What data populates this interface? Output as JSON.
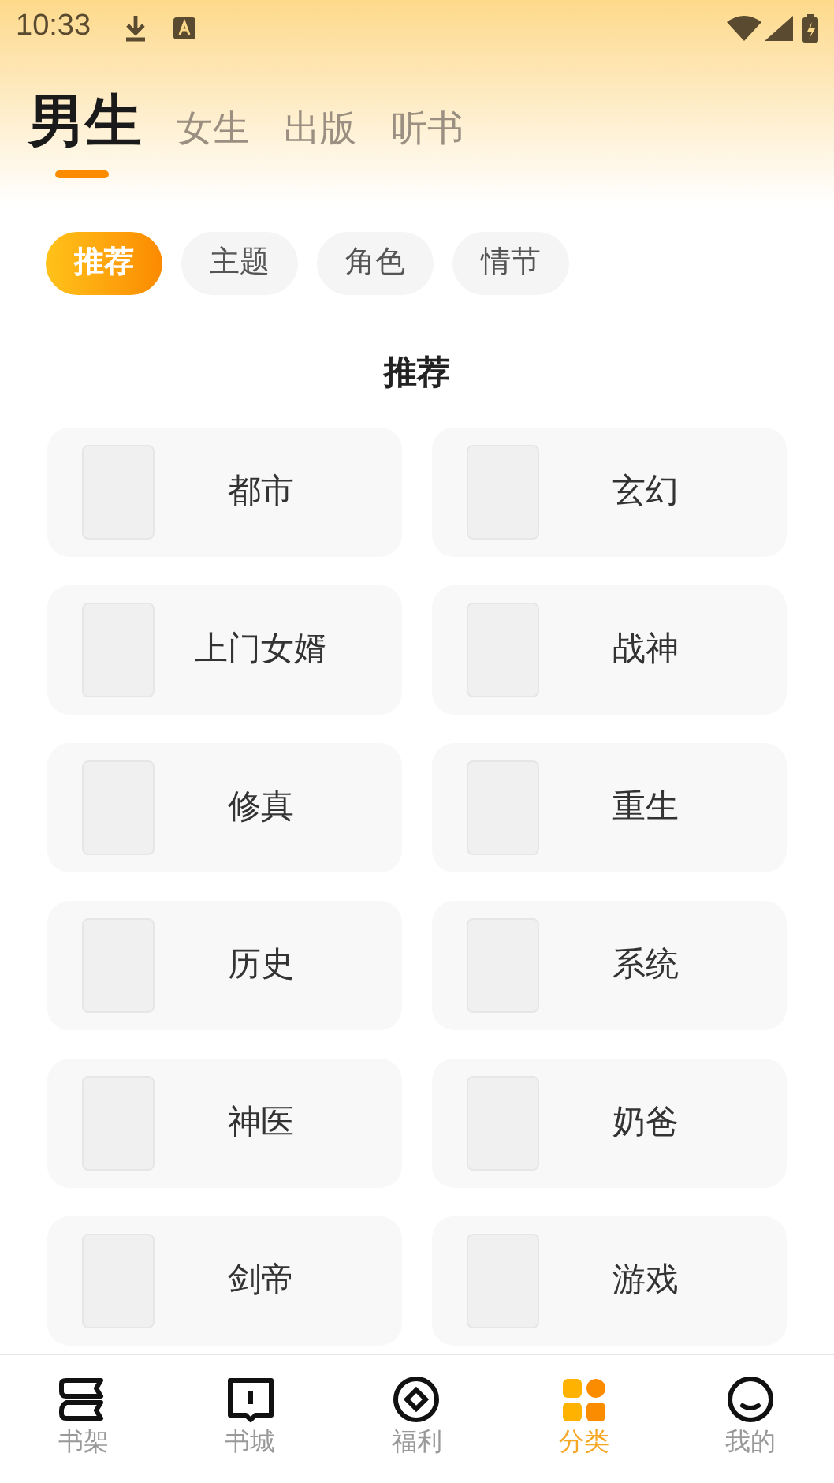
{
  "status_bar": {
    "time": "10:33"
  },
  "top_tabs": [
    {
      "label": "男生",
      "selected": true
    },
    {
      "label": "女生",
      "selected": false
    },
    {
      "label": "出版",
      "selected": false
    },
    {
      "label": "听书",
      "selected": false
    }
  ],
  "filter_chips": [
    {
      "label": "推荐",
      "selected": true
    },
    {
      "label": "主题",
      "selected": false
    },
    {
      "label": "角色",
      "selected": false
    },
    {
      "label": "情节",
      "selected": false
    }
  ],
  "section_title": "推荐",
  "categories": [
    "都市",
    "玄幻",
    "上门女婿",
    "战神",
    "修真",
    "重生",
    "历史",
    "系统",
    "神医",
    "奶爸",
    "剑帝",
    "游戏"
  ],
  "bottom_nav": [
    {
      "kind": "shelf",
      "label": "书架",
      "selected": false
    },
    {
      "kind": "store",
      "label": "书城",
      "selected": false
    },
    {
      "kind": "rewards",
      "label": "福利",
      "selected": false
    },
    {
      "kind": "categories",
      "label": "分类",
      "selected": true
    },
    {
      "kind": "profile",
      "label": "我的",
      "selected": false
    }
  ]
}
